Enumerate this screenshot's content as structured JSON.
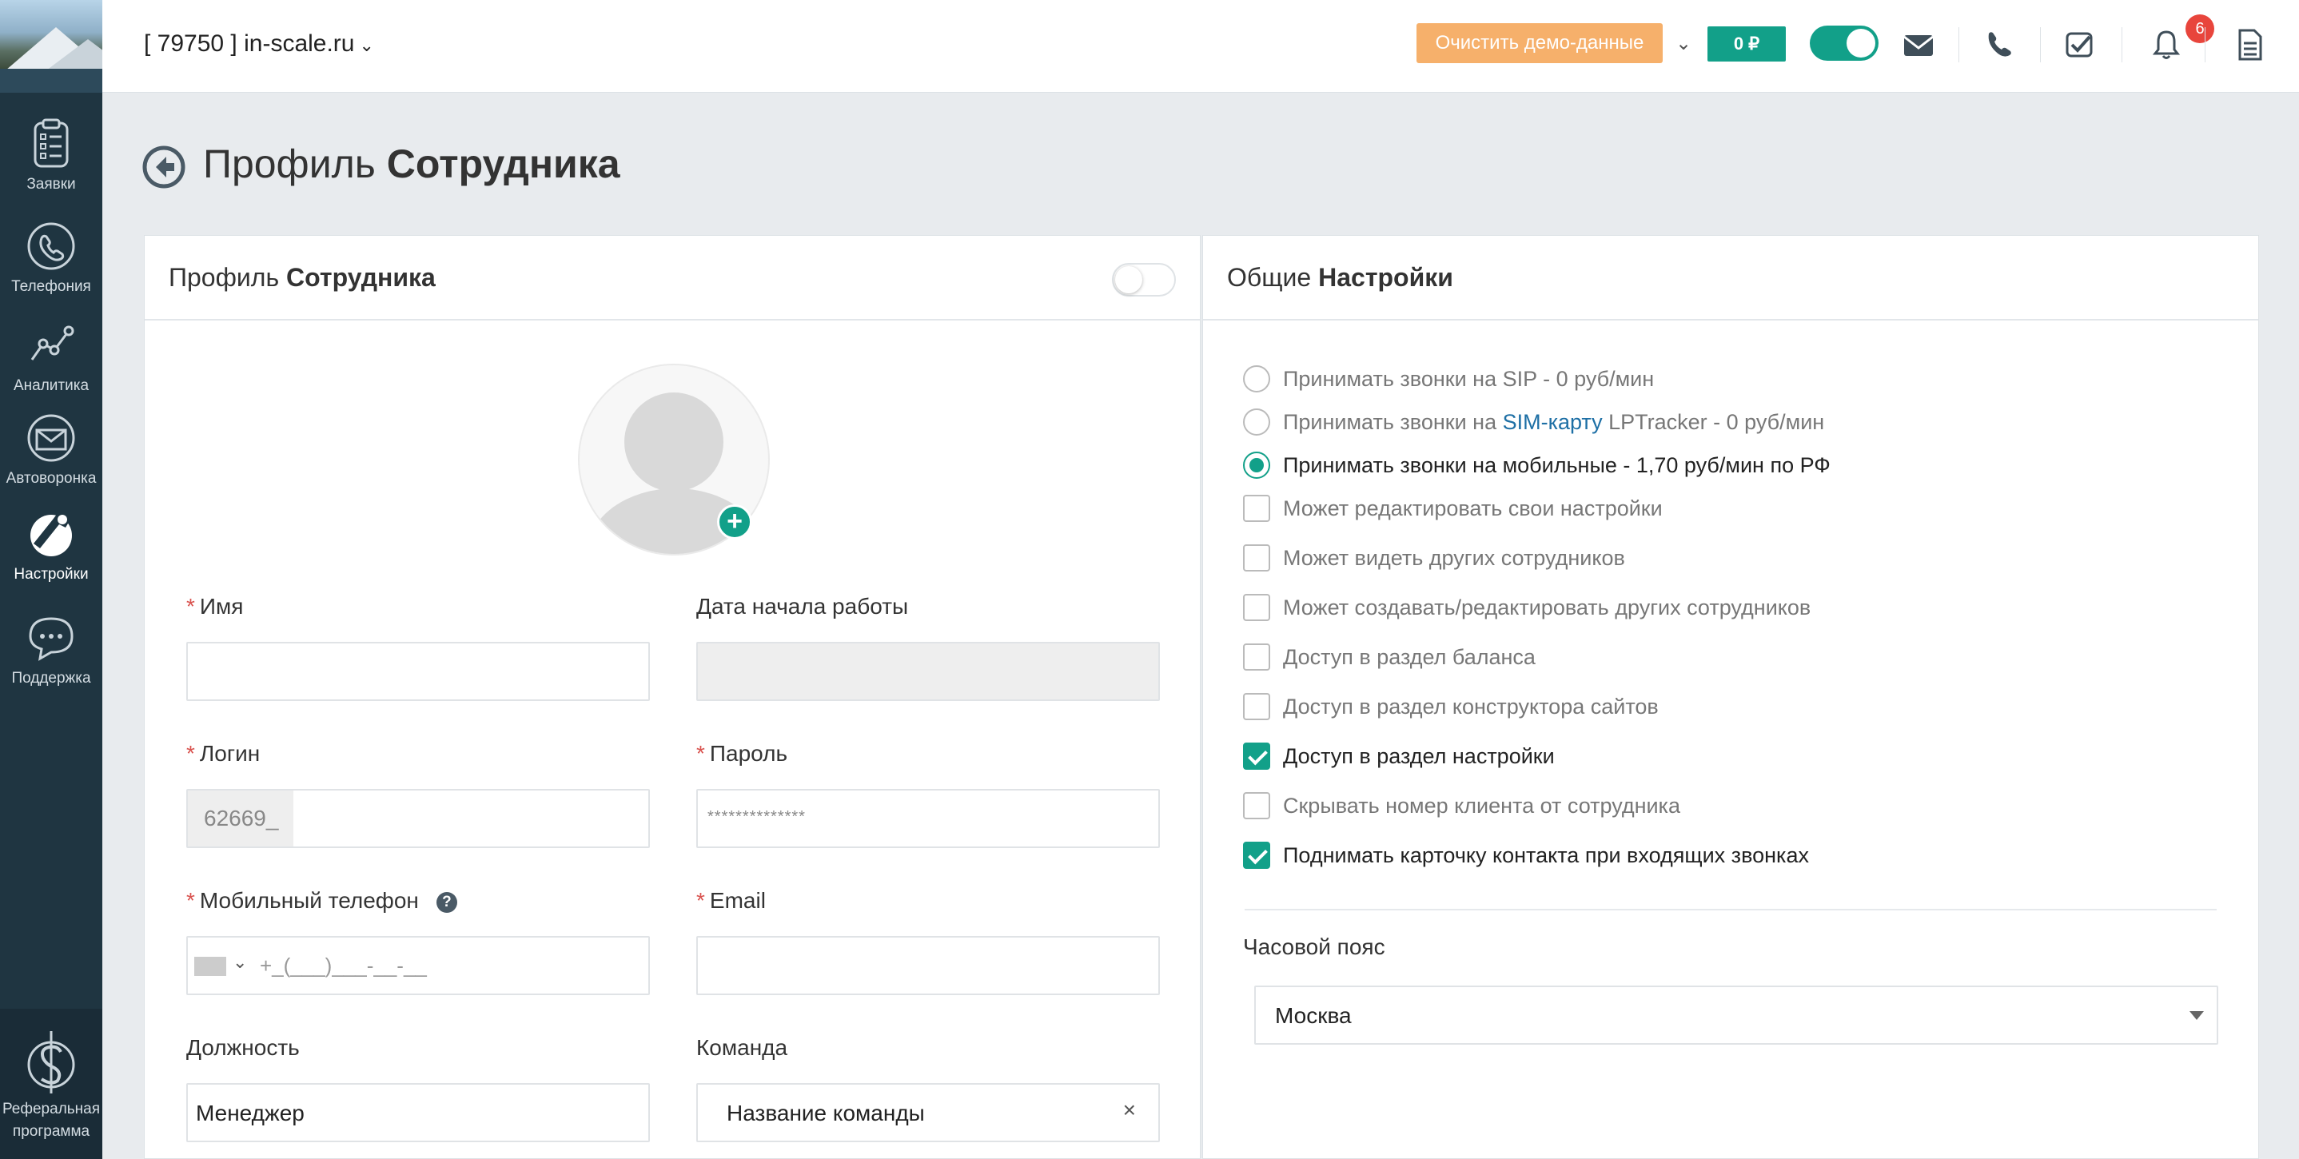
{
  "topbar": {
    "domain": "[ 79750 ] in-scale.ru",
    "demo_button": "Очистить демо-данные",
    "balance": "0 ₽",
    "tasks_badge": "6"
  },
  "sidebar": {
    "items": [
      {
        "label": "Заявки",
        "icon": "clipboard-list-icon"
      },
      {
        "label": "Телефония",
        "icon": "phone-icon"
      },
      {
        "label": "Аналитика",
        "icon": "analytics-icon"
      },
      {
        "label": "Автоворонка",
        "icon": "envelope-icon"
      },
      {
        "label": "Настройки",
        "icon": "wrench-icon"
      },
      {
        "label": "Поддержка",
        "icon": "chat-icon"
      }
    ],
    "referral": {
      "line1": "Реферальная",
      "line2": "программа",
      "icon": "dollar-icon"
    }
  },
  "page": {
    "title_light": "Профиль",
    "title_bold": "Сотрудника"
  },
  "profile": {
    "head_light": "Профиль",
    "head_bold": "Сотрудника",
    "name_label": "Имя",
    "start_date_label": "Дата начала работы",
    "login_label": "Логин",
    "login_prefix": "62669_",
    "password_label": "Пароль",
    "password_value": "**************",
    "phone_label": "Мобильный телефон",
    "phone_mask": "+_(___)___-__-__",
    "email_label": "Email",
    "position_label": "Должность",
    "position_value": "Менеджер",
    "team_label": "Команда",
    "team_value": "Название команды"
  },
  "settings": {
    "head_light": "Общие",
    "head_bold": "Настройки",
    "options": [
      {
        "type": "radio",
        "checked": false,
        "text": "Принимать звонки на SIP - 0 руб/мин"
      },
      {
        "type": "radio",
        "checked": false,
        "text_before": "Принимать звонки на ",
        "link": "SIM-карту",
        "text_after": " LPTracker - 0 руб/мин"
      },
      {
        "type": "radio",
        "checked": true,
        "text": "Принимать звонки на мобильные - 1,70 руб/мин по РФ"
      },
      {
        "type": "checkbox",
        "checked": false,
        "text": "Может редактировать свои настройки"
      },
      {
        "type": "checkbox",
        "checked": false,
        "text": "Может видеть других сотрудников"
      },
      {
        "type": "checkbox",
        "checked": false,
        "text": "Может создавать/редактировать других сотрудников"
      },
      {
        "type": "checkbox",
        "checked": false,
        "text": "Доступ в раздел баланса"
      },
      {
        "type": "checkbox",
        "checked": false,
        "text": "Доступ в раздел конструктора сайтов"
      },
      {
        "type": "checkbox",
        "checked": true,
        "text": "Доступ в раздел настройки"
      },
      {
        "type": "checkbox",
        "checked": false,
        "text": "Скрывать номер клиента от сотрудника"
      },
      {
        "type": "checkbox",
        "checked": true,
        "text": "Поднимать карточку контакта при входящих звонках"
      }
    ],
    "timezone_label": "Часовой пояс",
    "timezone_value": "Москва"
  },
  "colors": {
    "accent": "#12a089",
    "sidebar": "#1f3541",
    "demo_button": "#f6b06b",
    "badge": "#e8453c",
    "required": "#d9534f",
    "link": "#1d6fa5"
  }
}
